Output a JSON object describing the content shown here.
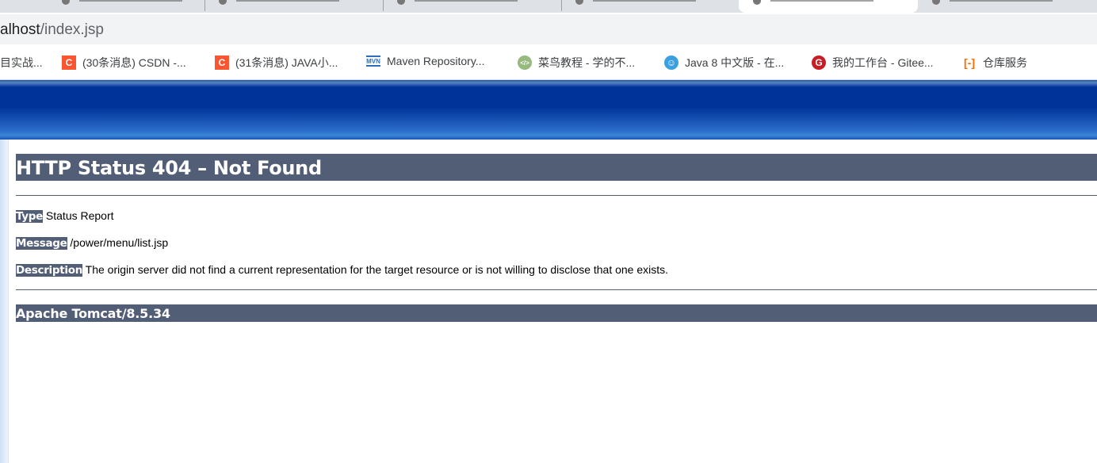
{
  "browser": {
    "url_host_part": "alhost",
    "url_path": "/index.jsp",
    "bookmarks": [
      {
        "label": "目实战...",
        "icon": "none",
        "color": ""
      },
      {
        "label": "(30条消息) CSDN -...",
        "icon": "csdn-icon",
        "color": "#fc5531"
      },
      {
        "label": "(31条消息) JAVA小...",
        "icon": "csdn-icon",
        "color": "#fc5531"
      },
      {
        "label": "Maven Repository...",
        "icon": "maven-icon",
        "color": "#2a6ebb"
      },
      {
        "label": "菜鸟教程 - 学的不...",
        "icon": "runoob-icon",
        "color": "#96b97d"
      },
      {
        "label": "Java 8 中文版 - 在...",
        "icon": "java-doc-icon",
        "color": "#3aa0e0"
      },
      {
        "label": "我的工作台 - Gitee...",
        "icon": "gitee-icon",
        "color": "#c71d23"
      },
      {
        "label": "仓库服务",
        "icon": "aliyun-icon",
        "color": "#ff6a00"
      }
    ]
  },
  "page": {
    "title": "HTTP Status 404 – Not Found",
    "type_label": "Type",
    "type_value": "Status Report",
    "message_label": "Message",
    "message_value": "/power/menu/list.jsp",
    "description_label": "Description",
    "description_value": "The origin server did not find a current representation for the target resource or is not willing to disclose that one exists.",
    "footer": "Apache Tomcat/8.5.34"
  },
  "colors": {
    "heading_bg": "#525D76",
    "banner": "#003399"
  }
}
